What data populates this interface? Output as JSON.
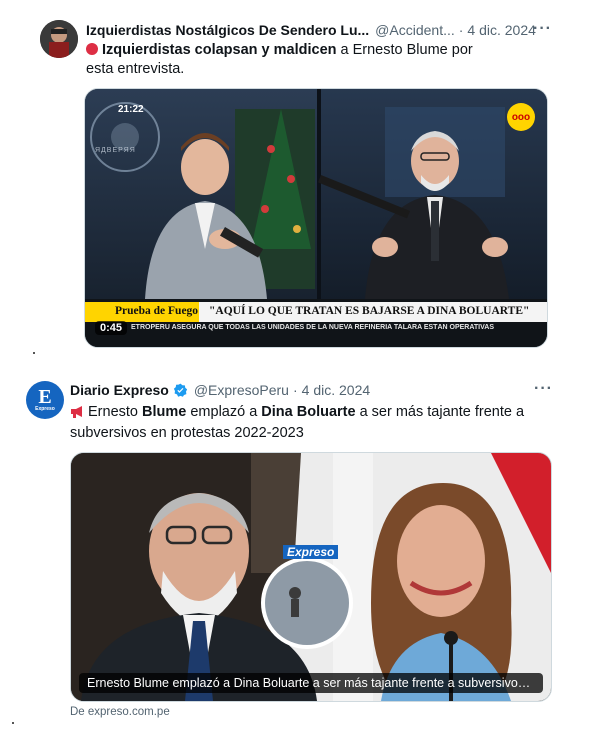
{
  "tweet1": {
    "author_name": "Izquierdistas Nostálgicos De Sendero Lu...",
    "handle": "@Accident...",
    "date": "4 dic. 2024",
    "more": "···",
    "text_bold": "Izquierdistas colapsan y maldicen",
    "text_rest": " a Ernesto Blume por esta entrevista.",
    "video": {
      "time_top": "21:22",
      "watermark": "ЯДВЕРЯЯ",
      "logo_text": "ooo",
      "show_label": "Prueba de Fuego",
      "headline": "\"AQUÍ LO QUE TRATAN ES BAJARSE A DINA BOLUARTE\"",
      "ticker": "ETROPERÚ ASEGURA QUE TODAS LAS UNIDADES DE LA NUEVA REFINERÍA TALARA ESTÁN OPERATIVAS",
      "duration": "0:45"
    }
  },
  "tweet2": {
    "author_name": "Diario Expreso",
    "handle": "@ExpresoPeru",
    "date": "4 dic. 2024",
    "more": "···",
    "avatar_letter": "E",
    "avatar_sub": "Expreso",
    "text_parts": [
      "Ernesto ",
      "Blume",
      " emplazó a ",
      "Dina Boluarte",
      " a ser más tajante frente a subversivos en protestas 2022-2023"
    ],
    "card": {
      "brand": "Expreso",
      "caption": "Ernesto Blume emplazó a Dina Boluarte a ser más tajante frente a subversivos ..."
    },
    "source": "De expreso.com.pe"
  },
  "colors": {
    "verified": "#1d9bf0",
    "alert_red": "#e0245e",
    "expreso_blue": "#1565c0",
    "logo_yellow": "#ffd400"
  }
}
